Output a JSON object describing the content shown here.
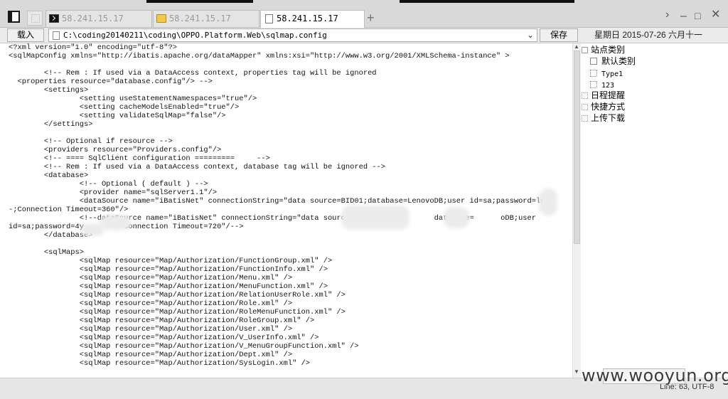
{
  "tabs": [
    {
      "label": "58.241.15.17",
      "icon": "terminal-icon"
    },
    {
      "label": "58.241.15.17",
      "icon": "folder-icon"
    },
    {
      "label": "58.241.15.17",
      "icon": "document-icon"
    }
  ],
  "toolbar": {
    "load_label": "载入",
    "path_value": "C:\\coding20140211\\coding\\OPPO.Platform.Web\\sqlmap.config",
    "save_label": "保存",
    "date_text": "星期日 2015-07-26 六月十一"
  },
  "editor": {
    "lines": [
      "<?xml version=\"1.0\" encoding=\"utf-8\"?>",
      "<sqlMapConfig xmlns=\"http://ibatis.apache.org/dataMapper\" xmlns:xsi=\"http://www.w3.org/2001/XMLSchema-instance\" >",
      "",
      "\t<!-- Rem : If used via a DataAccess context, properties tag will be ignored",
      "  <properties resource=\"database.config\"/> -->",
      "\t<settings>",
      "\t\t<setting useStatementNamespaces=\"true\"/>",
      "\t\t<setting cacheModelsEnabled=\"true\"/>",
      "\t\t<setting validateSqlMap=\"false\"/>",
      "\t</settings>",
      "",
      "\t<!-- Optional if resource -->",
      "\t<providers resource=\"Providers.config\"/>",
      "\t<!-- ==== SqlClient configuration =========     -->",
      "\t<!-- Rem : If used via a DataAccess context, database tag will be ignored -->",
      "\t<database>",
      "\t\t<!-- Optional ( default ) -->",
      "\t\t<provider name=\"sqlServer1.1\"/>",
      "\t\t<dataSource name=\"iBatisNet\" connectionString=\"data source=BID01;database=LenovoDB;user id=sa;password=le",
      "-;Connection Timeout=360\"/>",
      "\t\t<!--dataSource name=\"iBatisNet\" connectionString=\"data source=                  database=      oDB;user",
      "id=sa;password=4y         Connection Timeout=720\"/-->",
      "\t</database>",
      "",
      "\t<sqlMaps>",
      "\t\t<sqlMap resource=\"Map/Authorization/FunctionGroup.xml\" />",
      "\t\t<sqlMap resource=\"Map/Authorization/FunctionInfo.xml\" />",
      "\t\t<sqlMap resource=\"Map/Authorization/Menu.xml\" />",
      "\t\t<sqlMap resource=\"Map/Authorization/MenuFunction.xml\" />",
      "\t\t<sqlMap resource=\"Map/Authorization/RelationUserRole.xml\" />",
      "\t\t<sqlMap resource=\"Map/Authorization/Role.xml\" />",
      "\t\t<sqlMap resource=\"Map/Authorization/RoleMenuFunction.xml\" />",
      "\t\t<sqlMap resource=\"Map/Authorization/RoleGroup.xml\" />",
      "\t\t<sqlMap resource=\"Map/Authorization/User.xml\" />",
      "\t\t<sqlMap resource=\"Map/Authorization/V_UserInfo.xml\" />",
      "\t\t<sqlMap resource=\"Map/Authorization/V_MenuGroupFunction.xml\" />",
      "\t\t<sqlMap resource=\"Map/Authorization/Dept.xml\" />",
      "\t\t<sqlMap resource=\"Map/Authorization/SysLogin.xml\" />"
    ]
  },
  "sidebar": {
    "items": [
      {
        "label": "站点类别"
      },
      {
        "label": "默认类别"
      },
      {
        "label": "Type1"
      },
      {
        "label": "123"
      },
      {
        "label": "日程提醒"
      },
      {
        "label": "快捷方式"
      },
      {
        "label": "上传下载"
      }
    ]
  },
  "status": {
    "text": "Line: 63, UTF-8",
    "watermark": "www.wooyun.org"
  }
}
